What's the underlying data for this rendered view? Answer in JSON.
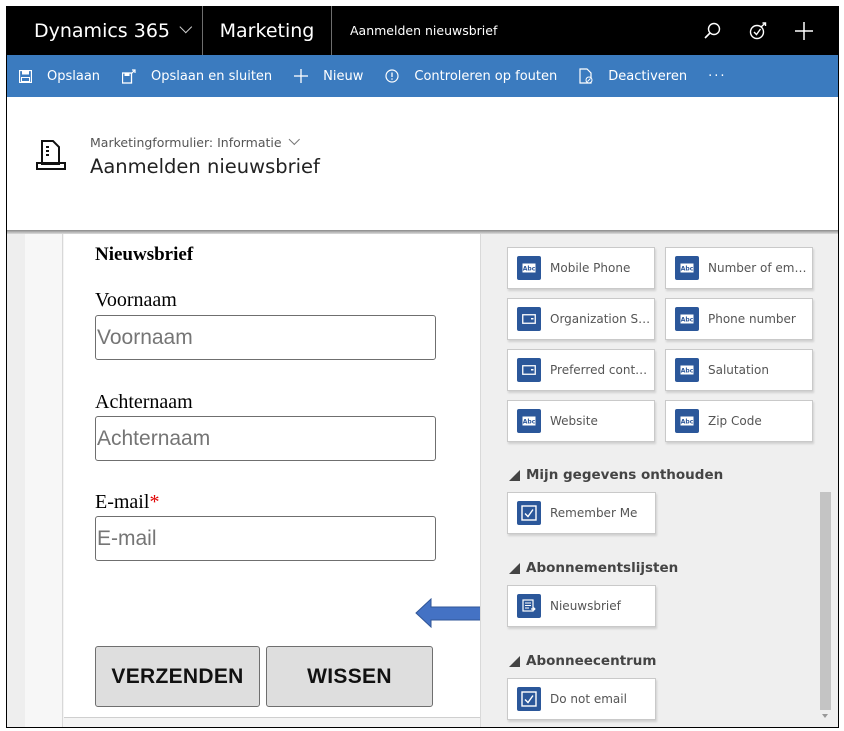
{
  "topnav": {
    "brand": "Dynamics 365",
    "app": "Marketing",
    "record_title": "Aanmelden nieuwsbrief",
    "icons": [
      "search-icon",
      "assistant-icon",
      "add-icon"
    ]
  },
  "commandbar": {
    "items": [
      {
        "label": "Opslaan",
        "icon": "save-icon"
      },
      {
        "label": "Opslaan en sluiten",
        "icon": "save-close-icon"
      },
      {
        "label": "Nieuw",
        "icon": "plus-icon"
      },
      {
        "label": "Controleren op fouten",
        "icon": "info-icon"
      },
      {
        "label": "Deactiveren",
        "icon": "deactivate-icon"
      }
    ],
    "more_label": "···"
  },
  "header": {
    "form_selector": "Marketingformulier: Informatie",
    "title": "Aanmelden nieuwsbrief"
  },
  "form_canvas": {
    "title": "Nieuwsbrief",
    "fields": [
      {
        "label": "Voornaam",
        "placeholder": "Voornaam",
        "required": false
      },
      {
        "label": "Achternaam",
        "placeholder": "Achternaam",
        "required": false
      },
      {
        "label": "E-mail",
        "placeholder": "E-mail",
        "required": true
      }
    ],
    "required_marker": "*",
    "buttons": {
      "submit": "VERZENDEN",
      "reset": "WISSEN"
    }
  },
  "toolbox": {
    "field_tiles": [
      {
        "label": "Mobile Phone",
        "icon": "text-field-icon"
      },
      {
        "label": "Number of emplo...",
        "icon": "text-field-icon"
      },
      {
        "label": "Organization Size",
        "icon": "dropdown-field-icon"
      },
      {
        "label": "Phone number",
        "icon": "text-field-icon"
      },
      {
        "label": "Preferred contact ...",
        "icon": "dropdown-field-icon"
      },
      {
        "label": "Salutation",
        "icon": "text-field-icon"
      },
      {
        "label": "Website",
        "icon": "text-field-icon"
      },
      {
        "label": "Zip Code",
        "icon": "text-field-icon"
      }
    ],
    "sections": [
      {
        "title": "Mijn gegevens onthouden",
        "tiles": [
          {
            "label": "Remember Me",
            "icon": "checkbox-icon"
          }
        ]
      },
      {
        "title": "Abonnementslijsten",
        "tiles": [
          {
            "label": "Nieuwsbrief",
            "icon": "subscription-list-icon"
          }
        ]
      },
      {
        "title": "Abonneecentrum",
        "tiles": [
          {
            "label": "Do not email",
            "icon": "checkbox-icon"
          }
        ]
      }
    ]
  },
  "colors": {
    "topnav_bg": "#000000",
    "commandbar_bg": "#3b7bbf",
    "tile_icon_bg": "#2b579a",
    "arrow": "#4472c4",
    "required": "#e00000"
  }
}
